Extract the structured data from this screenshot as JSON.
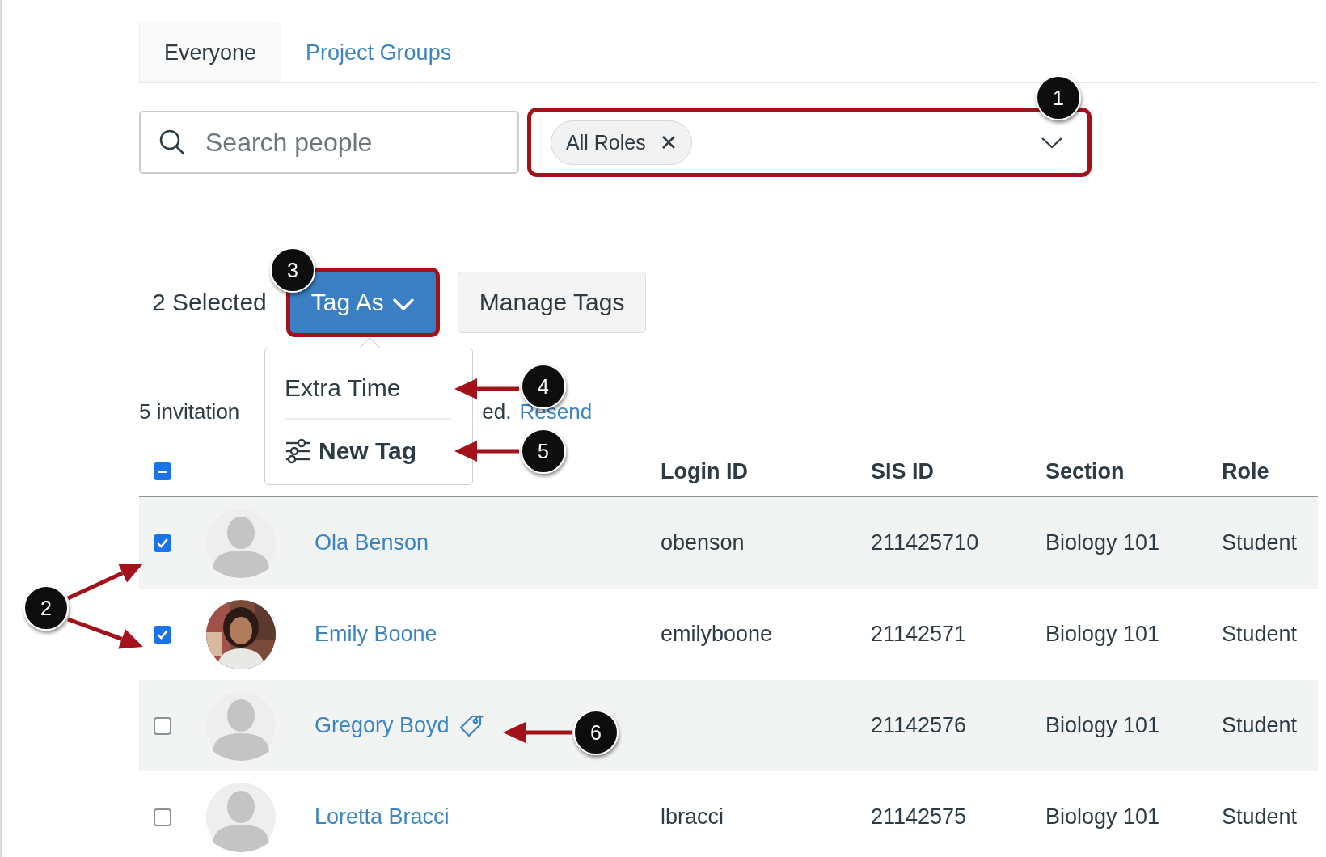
{
  "tabs": [
    {
      "label": "Everyone",
      "selected": true
    },
    {
      "label": "Project Groups",
      "selected": false
    }
  ],
  "search": {
    "placeholder": "Search people"
  },
  "role_filter": {
    "chips": [
      "All Roles"
    ],
    "highlighted": true
  },
  "bulk_bar": {
    "selected_count": "2 Selected",
    "buttons": [
      {
        "label": "Tag As",
        "kind": "dropdown",
        "highlighted": true
      },
      {
        "label": "Manage Tags",
        "kind": "plain",
        "highlighted": false
      }
    ]
  },
  "tag_menu": {
    "items": [
      {
        "label": "Extra Time",
        "kind": "tag"
      },
      {
        "label": "New Tag",
        "kind": "new"
      }
    ]
  },
  "notice": {
    "text_start": "5 invitation",
    "text_end": "ed.",
    "link": "Resend"
  },
  "table": {
    "select_all": {
      "indeterminate": true
    },
    "columns": [
      "Login ID",
      "SIS ID",
      "Section",
      "Role"
    ],
    "rows": [
      {
        "checked": true,
        "avatar": {
          "kind": "placeholder"
        },
        "name": "Ola Benson",
        "tagged": false,
        "login_id": "obenson",
        "sis_id": "211425710",
        "section": "Biology 101",
        "role": "Student"
      },
      {
        "checked": true,
        "name": "Emily Boone",
        "tagged": false,
        "login_id": "emilyboone",
        "sis_id": "21142571",
        "section": "Biology 101",
        "role": "Student"
      },
      {
        "checked": false,
        "avatar": {
          "kind": "placeholder"
        },
        "name": "Gregory Boyd",
        "tagged": true,
        "login_id": "",
        "sis_id": "21142576",
        "section": "Biology 101",
        "role": "Student"
      },
      {
        "checked": false,
        "avatar": {
          "kind": "placeholder"
        },
        "name": "Loretta Bracci",
        "tagged": false,
        "login_id": "lbracci",
        "sis_id": "21142575",
        "section": "Biology 101",
        "role": "Student"
      }
    ]
  },
  "callouts": [
    {
      "number": "1"
    },
    {
      "number": "2"
    },
    {
      "number": "3"
    },
    {
      "number": "4"
    },
    {
      "number": "5"
    },
    {
      "number": "6"
    }
  ]
}
